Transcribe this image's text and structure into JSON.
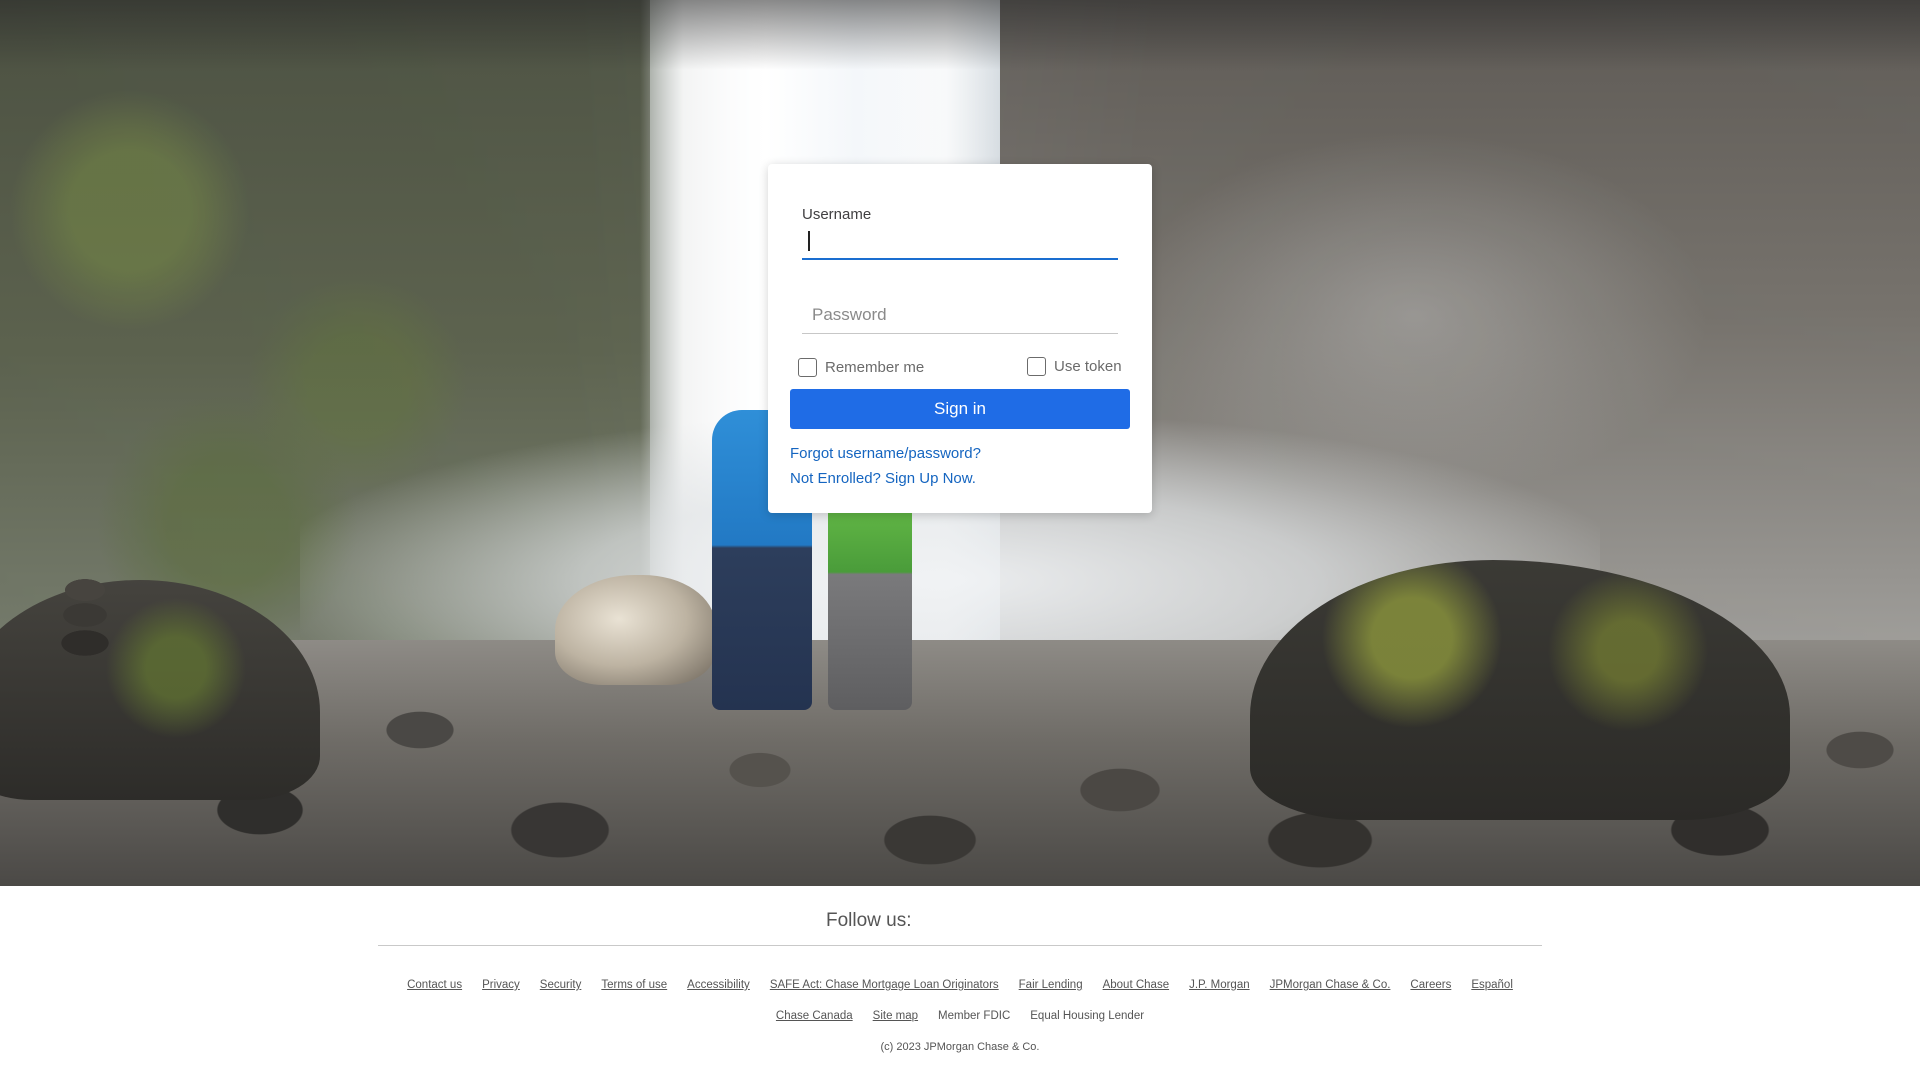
{
  "login": {
    "username_label": "Username",
    "username_value": "",
    "password_placeholder": "Password",
    "remember_me_label": "Remember me",
    "use_token_label": "Use token",
    "sign_in_label": "Sign in",
    "forgot_link": "Forgot username/password?",
    "enroll_link": "Not Enrolled? Sign Up Now."
  },
  "footer": {
    "follow_us": "Follow us:",
    "links_row1": [
      "Contact us",
      "Privacy",
      "Security",
      "Terms of use",
      "Accessibility",
      "SAFE Act: Chase Mortgage Loan Originators",
      "Fair Lending",
      "About Chase",
      "J.P. Morgan",
      "JPMorgan Chase & Co.",
      "Careers",
      "Español"
    ],
    "links_row2": [
      "Chase Canada",
      "Site map"
    ],
    "member_fdic": "Member FDIC",
    "equal_housing": "Equal Housing Lender",
    "copyright": "(c) 2023 JPMorgan Chase & Co."
  },
  "colors": {
    "primary_button": "#1f6ce6",
    "link": "#1565c0",
    "input_focus": "#1a6ed0"
  }
}
